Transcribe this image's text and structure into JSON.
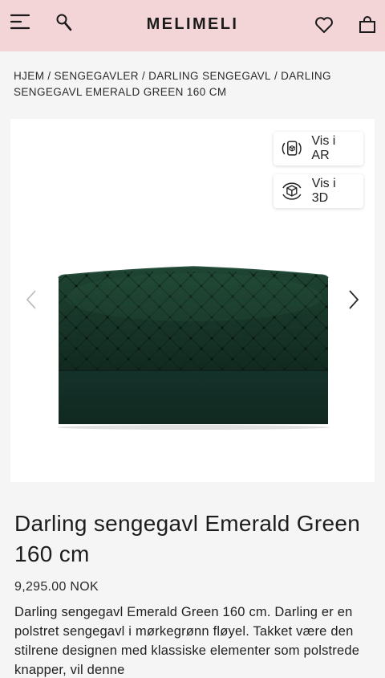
{
  "header": {
    "logo": "MELIMELI",
    "icons": [
      "menu-icon",
      "search-icon",
      "heart-icon",
      "shopping-bag-icon"
    ],
    "background": "#f3d5d8"
  },
  "breadcrumb": [
    {
      "label": "HJEM"
    },
    {
      "label": "SENGEGAVLER"
    },
    {
      "label": "DARLING SENGEGAVL"
    },
    {
      "label": "DARLING SENGEGAVL EMERALD GREEN 160 CM"
    }
  ],
  "gallery": {
    "ar_label": "Vis i AR",
    "d3_label": "Vis i 3D",
    "icons": [
      "ar-icon",
      "3d-cube-icon",
      "chevron-left-icon",
      "chevron-right-icon"
    ],
    "product_color": "#1b3a2c"
  },
  "product": {
    "title": "Darling sengegavl Emerald Green 160 cm",
    "price": "9,295.00 NOK",
    "description": "Darling sengegavl Emerald Green 160 cm. Darling er en polstret sengegavl i mørkegrønn fløyel. Takket være den stilrene designen med klassiske elementer som polstrede knapper, vil denne"
  }
}
